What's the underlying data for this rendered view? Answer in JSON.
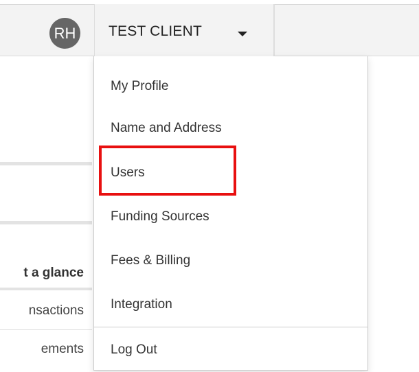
{
  "header": {
    "avatar_initials": "RH",
    "client_name": "TEST CLIENT",
    "caret_icon": "caret-down-icon"
  },
  "background_panel": {
    "items": [
      "t a glance",
      "nsactions",
      "ements"
    ]
  },
  "dropdown": {
    "items": [
      "My Profile",
      "Name and Address",
      "Users",
      "Funding Sources",
      "Fees & Billing",
      "Integration"
    ],
    "logout_label": "Log Out",
    "highlighted_item": "Users",
    "highlight_color": "#e81010"
  },
  "colors": {
    "topbar_bg": "#f3f3f3",
    "avatar_bg": "#666666",
    "text": "#333333"
  }
}
